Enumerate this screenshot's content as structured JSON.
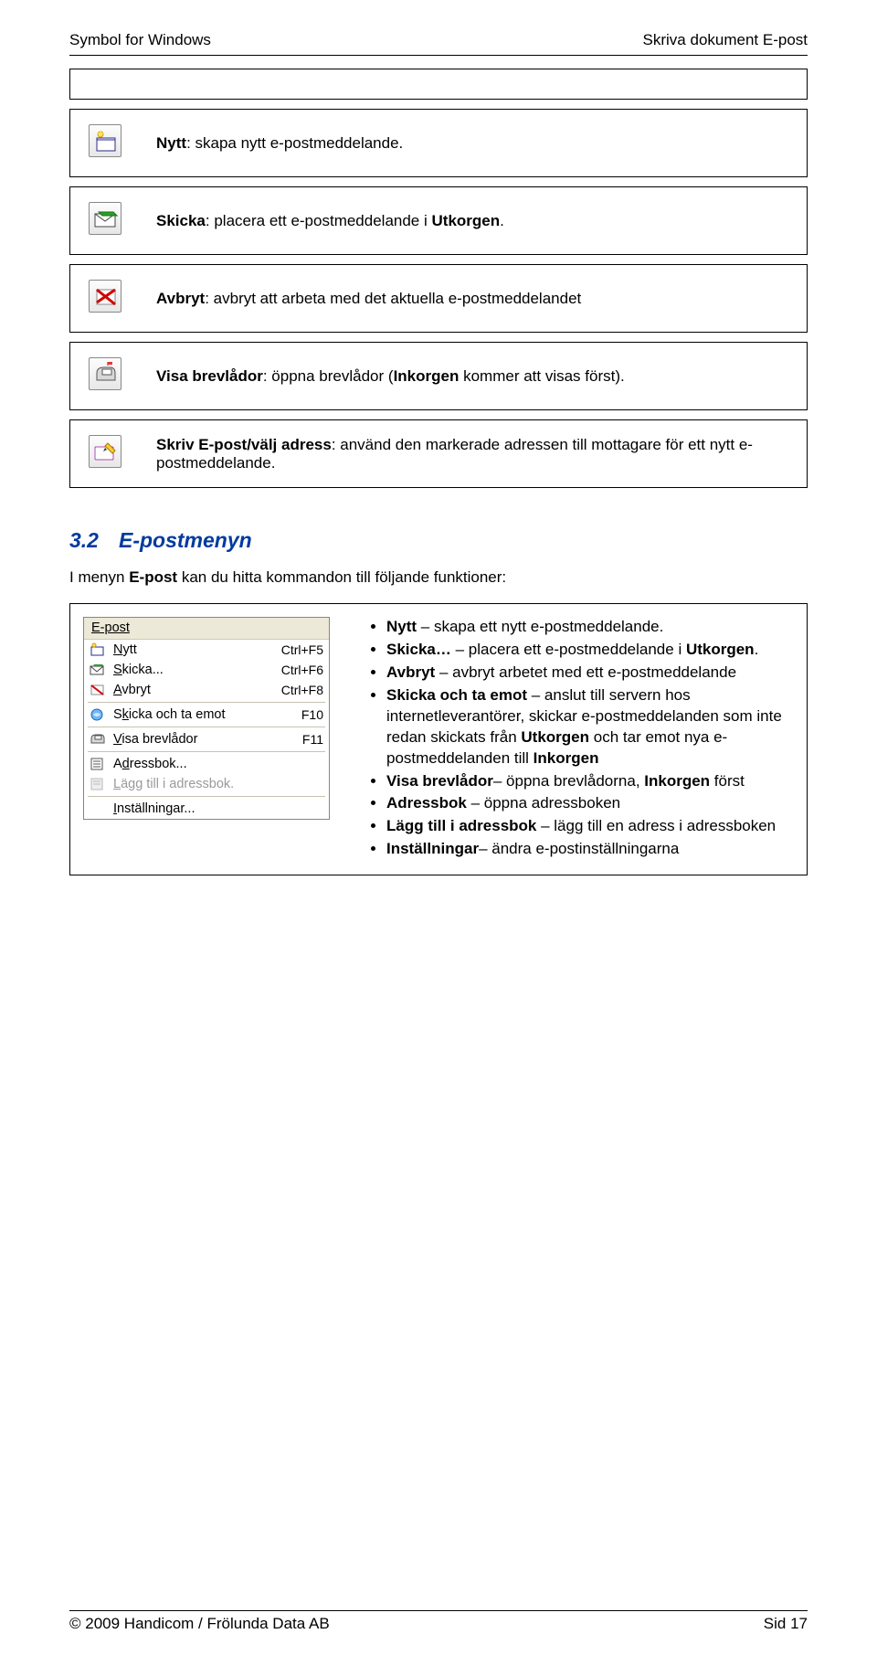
{
  "header": {
    "left": "Symbol for Windows",
    "right": "Skriva dokument E-post"
  },
  "iconBoxes": [
    {
      "bold": "Nytt",
      "rest": ": skapa nytt e-postmeddelande."
    },
    {
      "bold": "Skicka",
      "rest": ": placera ett e-postmeddelande i ",
      "boldTail": "Utkorgen",
      "tail": "."
    },
    {
      "bold": "Avbryt",
      "rest": ": avbryt att arbeta med det aktuella e-postmeddelandet"
    },
    {
      "bold": "Visa brevlådor",
      "rest": ": öppna brevlådor (",
      "boldTail": "Inkorgen",
      "tail": " kommer att visas först)."
    },
    {
      "bold": "Skriv E-post/välj adress",
      "rest": ": använd den markerade adressen till mottagare för ett nytt e-postmeddelande."
    }
  ],
  "section": {
    "num": "3.2",
    "title": "E-postmenyn",
    "intro_pre": "I menyn ",
    "intro_bold": "E-post",
    "intro_post": " kan du hitta kommandon till följande funktioner:"
  },
  "menu": {
    "title": "E-post",
    "items": [
      {
        "label_pre": "",
        "u": "N",
        "label_post": "ytt",
        "shortcut": "Ctrl+F5",
        "dis": false
      },
      {
        "label_pre": "",
        "u": "S",
        "label_post": "kicka...",
        "shortcut": "Ctrl+F6",
        "dis": false
      },
      {
        "label_pre": "",
        "u": "A",
        "label_post": "vbryt",
        "shortcut": "Ctrl+F8",
        "dis": false
      },
      {
        "sep": true
      },
      {
        "label_pre": "S",
        "u": "k",
        "label_post": "icka och ta emot",
        "shortcut": "F10",
        "dis": false
      },
      {
        "sep": true
      },
      {
        "label_pre": "",
        "u": "V",
        "label_post": "isa brevlådor",
        "shortcut": "F11",
        "dis": false
      },
      {
        "sep": true
      },
      {
        "label_pre": "A",
        "u": "d",
        "label_post": "ressbok...",
        "shortcut": "",
        "dis": false
      },
      {
        "label_pre": "",
        "u": "L",
        "label_post": "ägg till i adressbok.",
        "shortcut": "",
        "dis": true
      },
      {
        "sep": true
      },
      {
        "label_pre": "",
        "u": "I",
        "label_post": "nställningar...",
        "shortcut": "",
        "dis": false
      }
    ]
  },
  "bullets": [
    {
      "b": "Nytt",
      "t": " – skapa ett nytt e-postmeddelande."
    },
    {
      "b": "Skicka…",
      "t": " – placera ett e-postmeddelande i ",
      "b2": "Utkorgen",
      "t2": "."
    },
    {
      "b": "Avbryt",
      "t": " – avbryt arbetet med ett e-postmeddelande"
    },
    {
      "b": "Skicka och ta emot",
      "t": " – anslut till servern hos internetleverantörer, skickar e-postmeddelanden som inte redan skickats från ",
      "b2": "Utkorgen",
      "t2": " och tar emot nya e-postmeddelanden till ",
      "b3": "Inkorgen"
    },
    {
      "b": "Visa brevlådor",
      "t": "– öppna brevlådorna, ",
      "b2": "Inkorgen",
      "t2": " först"
    },
    {
      "b": "Adressbok",
      "t": " – öppna adressboken"
    },
    {
      "b": "Lägg till i adressbok",
      "t": " – lägg till en adress i adressboken"
    },
    {
      "b": "Inställningar",
      "t": "– ändra e-postinställningarna"
    }
  ],
  "footer": {
    "left": "© 2009 Handicom / Frölunda Data AB",
    "right": "Sid 17"
  }
}
